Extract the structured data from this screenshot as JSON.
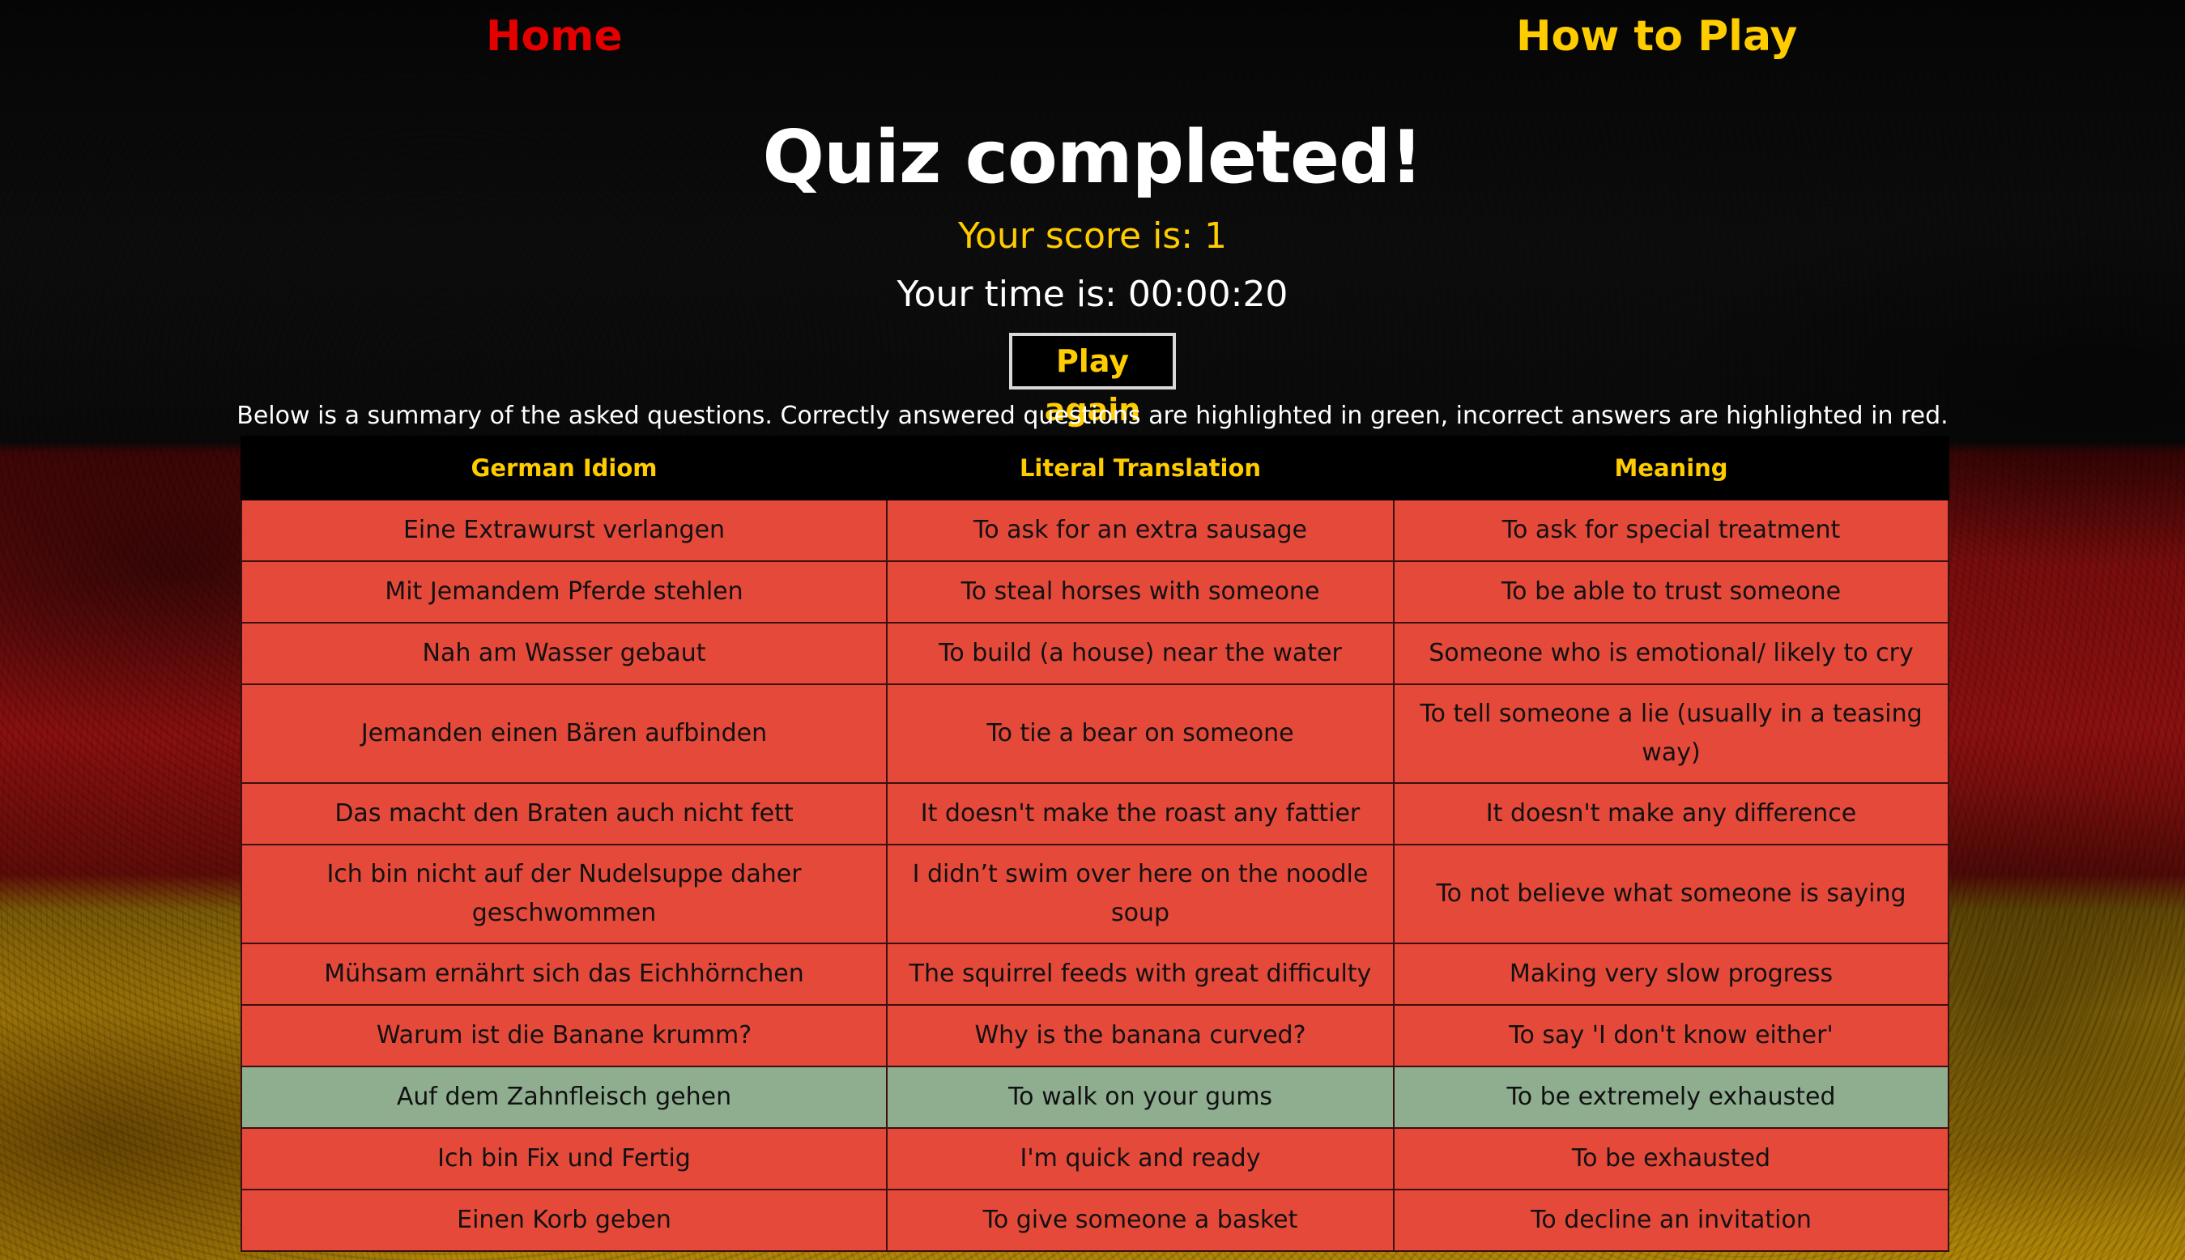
{
  "nav": {
    "home_label": "Home",
    "howto_label": "How to Play"
  },
  "result": {
    "title": "Quiz completed!",
    "score_text": "Your score is: 1",
    "time_text": "Your time is: 00:00:20",
    "play_again_label": "Play again",
    "summary_text": "Below is a summary of the asked questions. Correctly answered questions are highlighted in green, incorrect answers are highlighted in red."
  },
  "table": {
    "headers": [
      "German Idiom",
      "Literal Translation",
      "Meaning"
    ],
    "rows": [
      {
        "idiom": "Eine Extrawurst verlangen",
        "literal": "To ask for an extra sausage",
        "meaning": "To ask for special treatment",
        "correct": false
      },
      {
        "idiom": "Mit Jemandem Pferde stehlen",
        "literal": "To steal horses with someone",
        "meaning": "To be able to trust someone",
        "correct": false
      },
      {
        "idiom": "Nah am Wasser gebaut",
        "literal": "To build (a house) near the water",
        "meaning": "Someone who is emotional/ likely to cry",
        "correct": false
      },
      {
        "idiom": "Jemanden einen Bären aufbinden",
        "literal": "To tie a bear on someone",
        "meaning": "To tell someone a lie (usually in a teasing way)",
        "correct": false
      },
      {
        "idiom": "Das macht den Braten auch nicht fett",
        "literal": "It doesn't make the roast any fattier",
        "meaning": "It doesn't make any difference",
        "correct": false
      },
      {
        "idiom": "Ich bin nicht auf der Nudelsuppe daher geschwommen",
        "literal": "I didn’t swim over here on the noodle soup",
        "meaning": "To not believe what someone is saying",
        "correct": false
      },
      {
        "idiom": "Mühsam ernährt sich das Eichhörnchen",
        "literal": "The squirrel feeds with great difficulty",
        "meaning": "Making very slow progress",
        "correct": false
      },
      {
        "idiom": "Warum ist die Banane krumm?",
        "literal": "Why is the banana curved?",
        "meaning": "To say 'I don't know either'",
        "correct": false
      },
      {
        "idiom": "Auf dem Zahnfleisch gehen",
        "literal": "To walk on your gums",
        "meaning": "To be extremely exhausted",
        "correct": true
      },
      {
        "idiom": "Ich bin Fix und Fertig",
        "literal": "I'm quick and ready",
        "meaning": "To be exhausted",
        "correct": false
      },
      {
        "idiom": "Einen Korb geben",
        "literal": "To give someone a basket",
        "meaning": "To decline an invitation",
        "correct": false
      }
    ]
  },
  "colors": {
    "accent_gold": "#ffcc00",
    "home_red": "#e50000",
    "incorrect_row": "#e5493a",
    "correct_row": "#8fae90"
  }
}
